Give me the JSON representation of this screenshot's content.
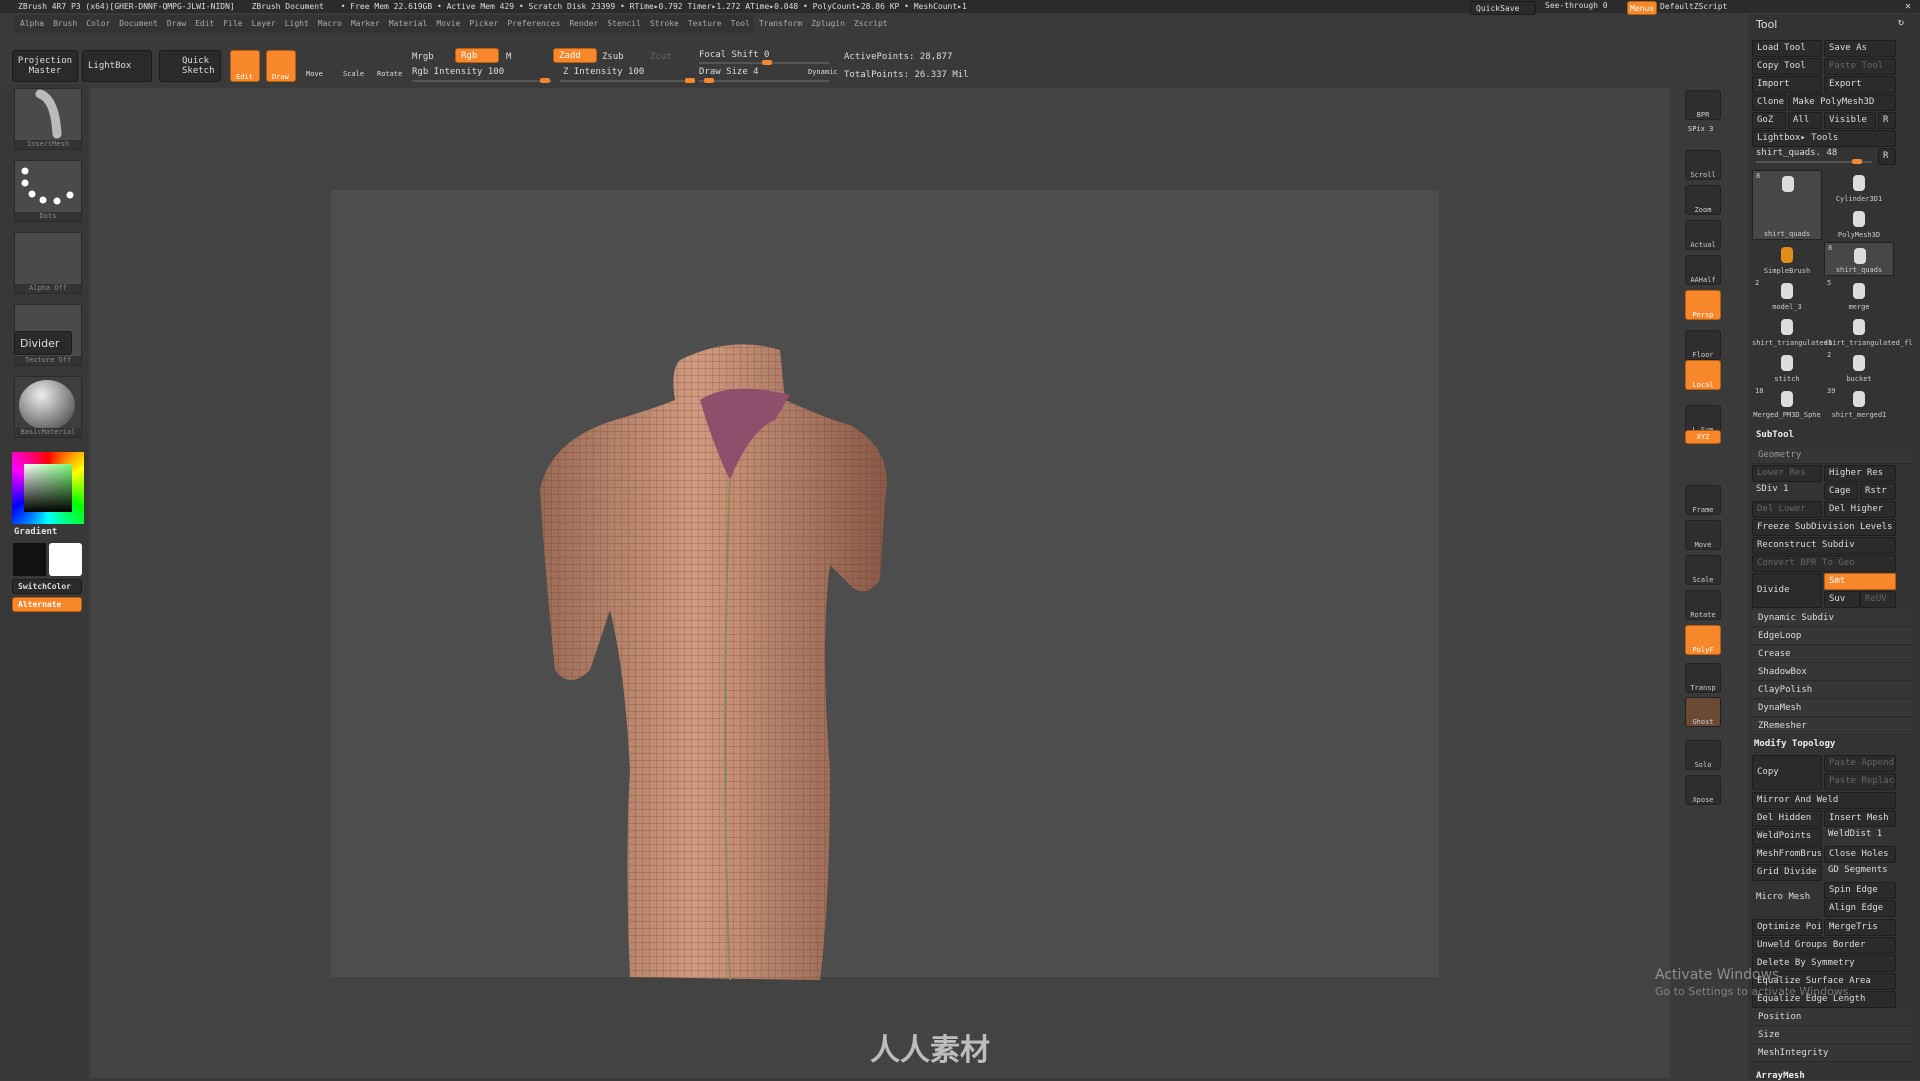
{
  "titlebar": {
    "title": "ZBrush 4R7 P3 (x64)[GHER-DNNF-QMPG-JLWI-NIDN]",
    "document": "ZBrush Document",
    "stats": "• Free Mem 22.619GB • Active Mem 429 • Scratch Disk 23399 • RTime▸0.792 Timer▸1.272 ATime▸0.048 • PolyCount▸28.86 KP • MeshCount▸1",
    "quicksave": "QuickSave",
    "see_through": "See-through  0",
    "menus": "Menus",
    "default_zscript": "DefaultZScript"
  },
  "menu": [
    "Alpha",
    "Brush",
    "Color",
    "Document",
    "Draw",
    "Edit",
    "File",
    "Layer",
    "Light",
    "Macro",
    "Marker",
    "Material",
    "Movie",
    "Picker",
    "Preferences",
    "Render",
    "Stencil",
    "Stroke",
    "Texture",
    "Tool",
    "Transform",
    "Zplugin",
    "Zscript"
  ],
  "toolbar": {
    "projection_master": "Projection Master",
    "lightbox": "LightBox",
    "quick_sketch": "Quick Sketch",
    "edit": "Edit",
    "draw": "Draw",
    "move": "Move",
    "scale": "Scale",
    "rotate": "Rotate",
    "mrgb": "Mrgb",
    "rgb": "Rgb",
    "m": "M",
    "rgb_intensity": "Rgb Intensity 100",
    "zadd": "Zadd",
    "zsub": "Zsub",
    "zcut": "Zcut",
    "z_intensity": "Z Intensity 100",
    "focal_shift": "Focal Shift 0",
    "draw_size": "Draw Size 4",
    "dynamic": "Dynamic",
    "active_points": "ActivePoints: 28,877",
    "total_points": "TotalPoints: 26.337 Mil"
  },
  "leftshelf": {
    "brush": "InsertMesh",
    "stroke": "Dots",
    "alpha": "Alpha Off",
    "texture": "Texture Off",
    "divider": "Divider",
    "material": "BasicMaterial",
    "gradient": "Gradient",
    "switch_color": "SwitchColor",
    "alternate": "Alternate"
  },
  "rightshelf": [
    "BPR",
    "SPix 3",
    "Scroll",
    "Zoom",
    "Actual",
    "AAHalf",
    "Persp",
    "Floor",
    "Local",
    "L.Sym",
    "XYZ",
    "Frame",
    "Move",
    "Scale",
    "Rotate",
    "PolyF",
    "Transp",
    "Ghost",
    "Solo",
    "Xpose"
  ],
  "tool": {
    "title": "Tool",
    "load": "Load Tool",
    "save_as": "Save As",
    "copy": "Copy Tool",
    "paste": "Paste Tool",
    "import": "Import",
    "export": "Export",
    "clone": "Clone",
    "make_polymesh": "Make PolyMesh3D",
    "goz": "GoZ",
    "all": "All",
    "visible": "Visible",
    "r": "R",
    "lightbox_tools": "Lightbox▸ Tools",
    "current": "shirt_quads. 48",
    "grid": [
      {
        "name": "shirt_quads",
        "count": "8"
      },
      {
        "name": "Cylinder3D1",
        "count": ""
      },
      {
        "name": "PolyMesh3D",
        "count": ""
      },
      {
        "name": "SimpleBrush",
        "count": ""
      },
      {
        "name": "shirt_quads",
        "count": "8"
      },
      {
        "name": "model_3",
        "count": "2"
      },
      {
        "name": "merge",
        "count": "5"
      },
      {
        "name": "shirt_triangulated1",
        "count": ""
      },
      {
        "name": "shirt_triangulated_fl",
        "count": ""
      },
      {
        "name": "stitch",
        "count": ""
      },
      {
        "name": "bucket",
        "count": "2"
      },
      {
        "name": "Merged_PM3D_Sphe",
        "count": "18"
      },
      {
        "name": "shirt_merged1",
        "count": "39"
      }
    ]
  },
  "subtool": "SubTool",
  "geometry": {
    "title": "Geometry",
    "lower_res": "Lower Res",
    "higher_res": "Higher Res",
    "sdiv": "SDiv 1",
    "cage": "Cage",
    "rstr": "Rstr",
    "del_lower": "Del Lower",
    "del_higher": "Del Higher",
    "freeze": "Freeze SubDivision Levels",
    "reconstruct": "Reconstruct Subdiv",
    "convert_bpr": "Convert BPR To Geo",
    "divide": "Divide",
    "smt": "Smt",
    "suv": "Suv",
    "reuv": "ReUV",
    "sections": [
      "Dynamic Subdiv",
      "EdgeLoop",
      "Crease",
      "ShadowBox",
      "ClayPolish",
      "DynaMesh",
      "ZRemesher"
    ]
  },
  "modify": {
    "title": "Modify Topology",
    "copy": "Copy",
    "paste_append": "Paste Append",
    "paste_replace": "Paste Replace",
    "mirror_weld": "Mirror And Weld",
    "del_hidden": "Del Hidden",
    "insert_mesh": "Insert Mesh",
    "weldpoints": "WeldPoints",
    "welddist": "WeldDist 1",
    "meshfrombrush": "MeshFromBrush",
    "close_holes": "Close Holes",
    "grid_divide": "Grid Divide",
    "gd_segments": "GD Segments",
    "micro_mesh": "Micro Mesh",
    "spin_edge": "Spin Edge",
    "align_edge": "Align Edge",
    "optimize": "Optimize Points",
    "mergetris": "MergeTris",
    "unweld": "Unweld Groups Border",
    "delete_sym": "Delete By Symmetry",
    "equalize_area": "Equalize Surface Area",
    "equalize_edge": "Equalize Edge Length"
  },
  "more_sections": [
    "Position",
    "Size",
    "MeshIntegrity"
  ],
  "arraymesh": "ArrayMesh",
  "overlay": {
    "watermark": "人人素材",
    "activate": "Activate Windows",
    "activate_sub": "Go to Settings to activate Windows."
  },
  "colors": {
    "accent": "#f7872a",
    "panel": "#333333",
    "canvas": "#434343"
  }
}
